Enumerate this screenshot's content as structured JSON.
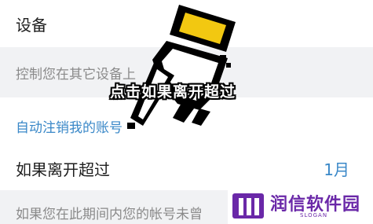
{
  "device_row": {
    "title": "设备"
  },
  "device_desc": {
    "text": "控制您在其它设备上"
  },
  "section": {
    "title": "自动注销我的账号"
  },
  "inactive_setting": {
    "label": "如果离开超过",
    "value": "1月"
  },
  "footer": {
    "text": "如果您在此期间内您的帐号未曾"
  },
  "overlay": {
    "caption": "点击如果离开超过"
  },
  "watermark": {
    "name": "润信软件园",
    "slogan": "SLOGAN"
  },
  "colors": {
    "accent": "#3a88c8",
    "muted": "#8a8a8a",
    "section_bg": "#f1f2f4",
    "cursor_fill": "#f2c811",
    "logo": "#6a28a8"
  },
  "icons": {
    "cursor": "pixel-hand-cursor-icon",
    "logo": "runxin-logo-icon"
  }
}
